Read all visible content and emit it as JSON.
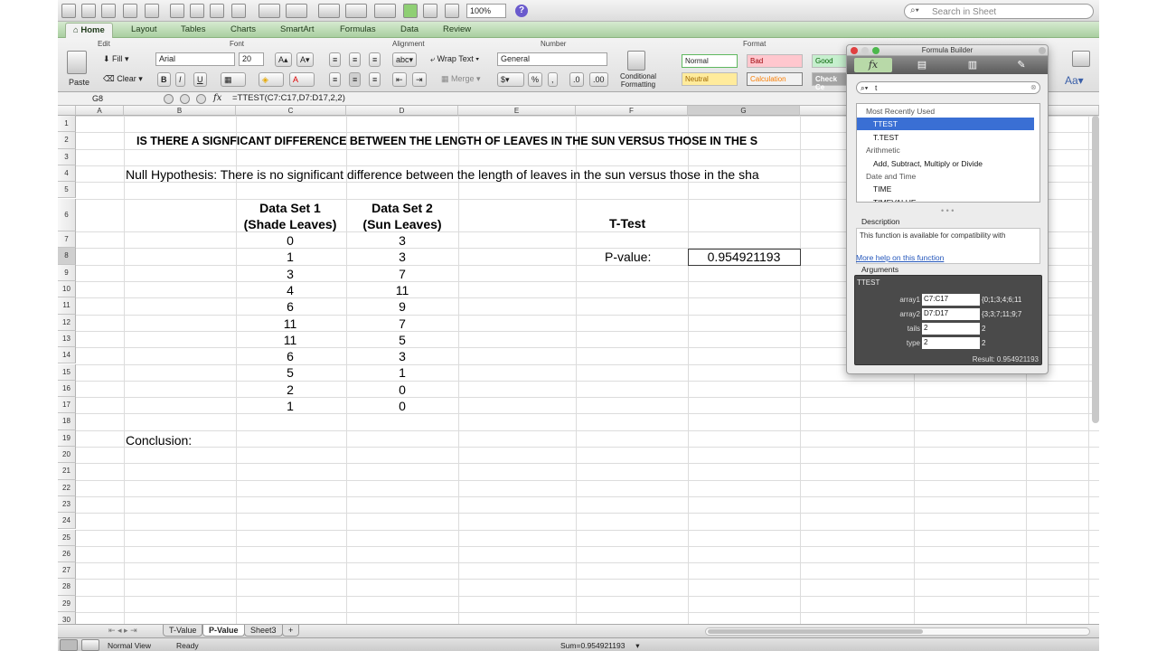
{
  "toolbar": {
    "zoom": "100%",
    "search_placeholder": "Search in Sheet"
  },
  "ribbon_tabs": [
    "Home",
    "Layout",
    "Tables",
    "Charts",
    "SmartArt",
    "Formulas",
    "Data",
    "Review"
  ],
  "ribbon": {
    "groups": {
      "edit": "Edit",
      "font": "Font",
      "alignment": "Alignment",
      "number": "Number",
      "format": "Format"
    },
    "paste": "Paste",
    "fill": "Fill",
    "clear": "Clear",
    "font_name": "Arial",
    "font_size": "20",
    "wrap_text": "Wrap Text",
    "merge": "Merge",
    "number_format": "General",
    "conditional_formatting": "Conditional Formatting",
    "styles": {
      "normal": "Normal",
      "bad": "Bad",
      "good": "Good",
      "neutral": "Neutral",
      "calculation": "Calculation",
      "check_cell": "Check Ce"
    }
  },
  "formula_bar": {
    "cell_ref": "G8",
    "formula": "=TTEST(C7:C17,D7:D17,2,2)"
  },
  "grid": {
    "columns": [
      "A",
      "B",
      "C",
      "D",
      "E",
      "F",
      "G"
    ],
    "rows": [
      "1",
      "2",
      "3",
      "4",
      "5",
      "6",
      "7",
      "8",
      "9",
      "10",
      "11",
      "12",
      "13",
      "14",
      "15",
      "16",
      "17",
      "18",
      "19",
      "20",
      "21",
      "22",
      "23",
      "24",
      "25",
      "26",
      "27",
      "28",
      "29",
      "30"
    ],
    "title": "IS THERE A SIGNFICANT DIFFERENCE BETWEEN THE LENGTH OF LEAVES IN THE SUN VERSUS THOSE IN THE S",
    "null_hypothesis": "Null Hypothesis:  There is no significant difference between the length of leaves in the sun versus those in the sha",
    "header_c": [
      "Data Set 1",
      "(Shade Leaves)"
    ],
    "header_d": [
      "Data Set 2",
      "(Sun Leaves)"
    ],
    "data_set_1": [
      "0",
      "1",
      "3",
      "4",
      "6",
      "11",
      "11",
      "6",
      "5",
      "2",
      "1"
    ],
    "data_set_2": [
      "3",
      "3",
      "7",
      "11",
      "9",
      "7",
      "5",
      "3",
      "1",
      "0",
      "0"
    ],
    "ttest_label": "T-Test",
    "pvalue_label": "P-value:",
    "pvalue": "0.954921193",
    "conclusion": "Conclusion:"
  },
  "sheet_tabs": [
    "T-Value",
    "P-Value",
    "Sheet3"
  ],
  "status": {
    "view": "Normal View",
    "ready": "Ready",
    "sum": "Sum=0.954921193"
  },
  "formula_builder": {
    "title": "Formula Builder",
    "search_value": "t",
    "list": [
      {
        "text": "Most Recently Used",
        "kind": "cat"
      },
      {
        "text": "TTEST",
        "kind": "fn",
        "selected": true
      },
      {
        "text": "T.TEST",
        "kind": "fn"
      },
      {
        "text": "Arithmetic",
        "kind": "cat"
      },
      {
        "text": "Add, Subtract, Multiply or Divide",
        "kind": "fn"
      },
      {
        "text": "Date and Time",
        "kind": "cat"
      },
      {
        "text": "TIME",
        "kind": "fn"
      },
      {
        "text": "TIMEVALUE",
        "kind": "fn"
      }
    ],
    "description_label": "Description",
    "description": "This function is available for compatibility with",
    "more_help": "More help on this function",
    "arguments_label": "Arguments",
    "function_name": "TTEST",
    "args": [
      {
        "name": "array1",
        "input": "C7:C17",
        "value": "{0;1;3;4;6;11"
      },
      {
        "name": "array2",
        "input": "D7:D17",
        "value": "{3;3;7;11;9;7"
      },
      {
        "name": "tails",
        "input": "2",
        "value": "2"
      },
      {
        "name": "type",
        "input": "2",
        "value": "2"
      }
    ],
    "result": "Result: 0.954921193"
  }
}
